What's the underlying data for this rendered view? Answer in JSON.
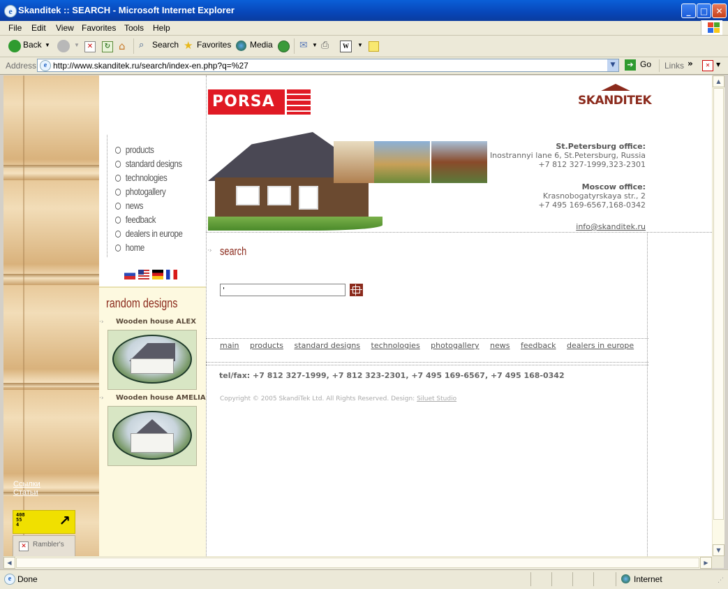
{
  "window": {
    "title": "Skanditek :: SEARCH - Microsoft Internet Explorer"
  },
  "menu": [
    "File",
    "Edit",
    "View",
    "Favorites",
    "Tools",
    "Help"
  ],
  "toolbar": {
    "back": "Back",
    "search": "Search",
    "favorites": "Favorites",
    "media": "Media"
  },
  "address": {
    "label": "Address",
    "url": "http://www.skanditek.ru/search/index-en.php?q=%27",
    "go": "Go",
    "links": "Links"
  },
  "nav": [
    "products",
    "standard designs",
    "technologies",
    "photogallery",
    "news",
    "feedback",
    "dealers in europe",
    "home"
  ],
  "brand": {
    "porsa": "PORSA",
    "skanditek": "SKANDITEK"
  },
  "offices": {
    "spb": {
      "title": "St.Petersburg office:",
      "address": "Inostrannyi lane 6, St.Petersburg, Russia",
      "phone": "+7 812 327-1999,323-2301"
    },
    "msk": {
      "title": "Moscow office:",
      "address": "Krasnobogatyrskaya str., 2",
      "phone": "+7 495 169-6567,168-0342"
    },
    "email": "info@skanditek.ru"
  },
  "random": {
    "title": "random designs",
    "houses": [
      "Wooden house ALEX",
      "Wooden house AMELIA"
    ]
  },
  "search": {
    "heading": "search",
    "value": "'"
  },
  "footnav": [
    "main",
    "products",
    "standard designs",
    "technologies",
    "photogallery",
    "news",
    "feedback",
    "dealers in europe"
  ],
  "telfax": "tel/fax: +7 812 327-1999, +7 812 323-2301, +7 495 169-6567, +7 495 168-0342",
  "copyright": {
    "text": "Copyright © 2005 SkandiTek Ltd. All Rights Reserved. Design: ",
    "designer": "Siluet Studio"
  },
  "woodlinks": [
    "Ссылки",
    "Статьи"
  ],
  "counters": {
    "top100_numbers": [
      "408",
      "55",
      "4"
    ],
    "rambler": "Rambler's"
  },
  "status": {
    "text": "Done",
    "zone": "Internet"
  },
  "colors": {
    "accent": "#8b2a1c",
    "porsa_red": "#e01a24",
    "xp_blue": "#0a5fd8"
  }
}
